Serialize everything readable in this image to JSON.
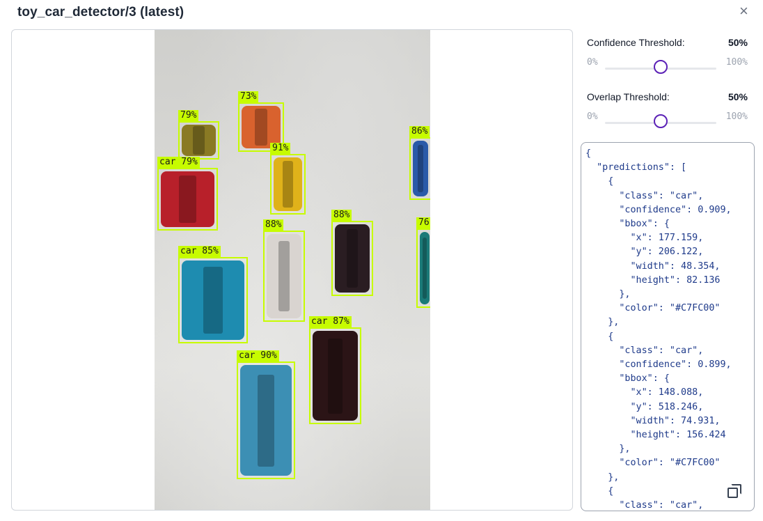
{
  "header": {
    "title": "toy_car_detector/3 (latest)",
    "close_glyph": "×"
  },
  "colors": {
    "box": "#C7FC00",
    "accent": "#5b21b6"
  },
  "detections": [
    {
      "label": "79%",
      "car_color": "#8a7a24"
    },
    {
      "label": "73%",
      "car_color": "#d9622e"
    },
    {
      "label": "91%",
      "car_color": "#e0b21a"
    },
    {
      "label": "86%",
      "car_color": "#2a5aa8"
    },
    {
      "label": "car 79%",
      "car_color": "#b8202a"
    },
    {
      "label": "88%",
      "car_color": "#d9d4d0"
    },
    {
      "label": "88%",
      "car_color": "#2a1d22"
    },
    {
      "label": "76",
      "car_color": "#1b7a78"
    },
    {
      "label": "car 85%",
      "car_color": "#1e8cb0"
    },
    {
      "label": "car 87%",
      "car_color": "#2b1416"
    },
    {
      "label": "car 90%",
      "car_color": "#3c8fb4"
    }
  ],
  "confidence": {
    "label": "Confidence Threshold:",
    "value": "50%",
    "min": "0%",
    "max": "100%",
    "level": 0.5
  },
  "overlap": {
    "label": "Overlap Threshold:",
    "value": "50%",
    "min": "0%",
    "max": "100%",
    "level": 0.5
  },
  "json_text": "{\n  \"predictions\": [\n    {\n      \"class\": \"car\",\n      \"confidence\": 0.909,\n      \"bbox\": {\n        \"x\": 177.159,\n        \"y\": 206.122,\n        \"width\": 48.354,\n        \"height\": 82.136\n      },\n      \"color\": \"#C7FC00\"\n    },\n    {\n      \"class\": \"car\",\n      \"confidence\": 0.899,\n      \"bbox\": {\n        \"x\": 148.088,\n        \"y\": 518.246,\n        \"width\": 74.931,\n        \"height\": 156.424\n      },\n      \"color\": \"#C7FC00\"\n    },\n    {\n      \"class\": \"car\",",
  "copy_icon": "copy-icon"
}
